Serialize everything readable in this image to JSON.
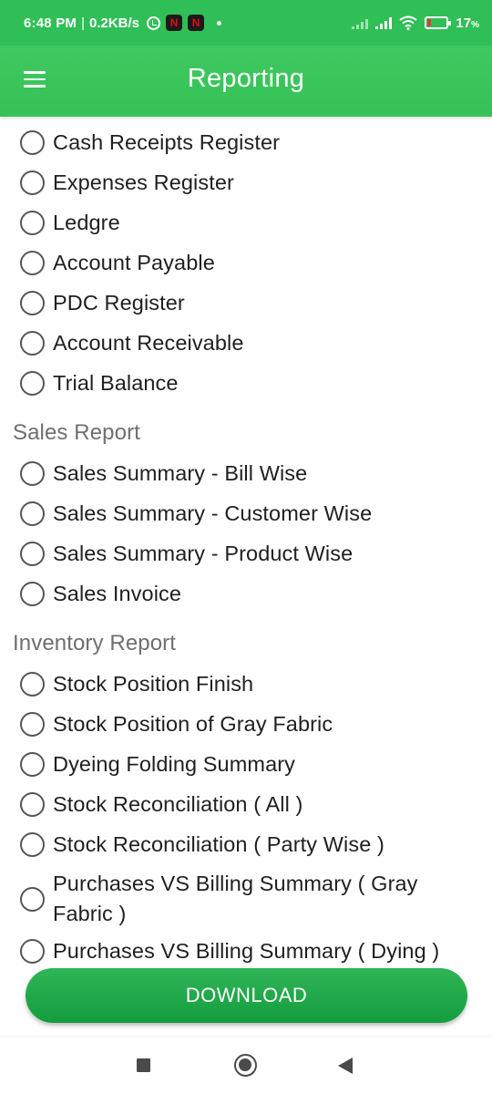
{
  "status_bar": {
    "time": "6:48 PM",
    "speed": "0.2KB/s",
    "separator": "|",
    "battery_percent": "17",
    "battery_unit": "%",
    "netflix_badge": "N",
    "icons": [
      "alarm-icon",
      "netflix-icon",
      "netflix-icon",
      "notification-dot-icon",
      "signal-icon",
      "signal-icon",
      "wifi-icon",
      "battery-icon"
    ]
  },
  "app_bar": {
    "title": "Reporting",
    "menu_icon": "hamburger-menu-icon"
  },
  "accounts_items": [
    {
      "label": "Cash Receipts Register"
    },
    {
      "label": "Expenses Register"
    },
    {
      "label": "Ledgre"
    },
    {
      "label": "Account Payable"
    },
    {
      "label": "PDC Register"
    },
    {
      "label": "Account Receivable"
    },
    {
      "label": "Trial Balance"
    }
  ],
  "sales_report": {
    "title": "Sales Report",
    "items": [
      {
        "label": "Sales Summary - Bill Wise"
      },
      {
        "label": "Sales Summary - Customer Wise"
      },
      {
        "label": "Sales Summary - Product Wise"
      },
      {
        "label": "Sales Invoice"
      }
    ]
  },
  "inventory_report": {
    "title": "Inventory Report",
    "items": [
      {
        "label": "Stock Position Finish"
      },
      {
        "label": "Stock Position of Gray Fabric"
      },
      {
        "label": "Dyeing Folding Summary"
      },
      {
        "label": "Stock Reconciliation ( All )"
      },
      {
        "label": "Stock Reconciliation ( Party Wise )"
      },
      {
        "label": "Purchases VS Billing Summary ( Gray Fabric )"
      },
      {
        "label": "Purchases VS Billing Summary ( Dying )"
      }
    ]
  },
  "download_button": {
    "label": "DOWNLOAD"
  },
  "nav_bar": {
    "icons": [
      "recents-square-icon",
      "home-circle-icon",
      "back-triangle-icon"
    ]
  },
  "colors": {
    "primary_green": "#35c257",
    "button_green": "#139d3e",
    "section_gray": "#6f6f6f",
    "radio_border": "#555555"
  }
}
